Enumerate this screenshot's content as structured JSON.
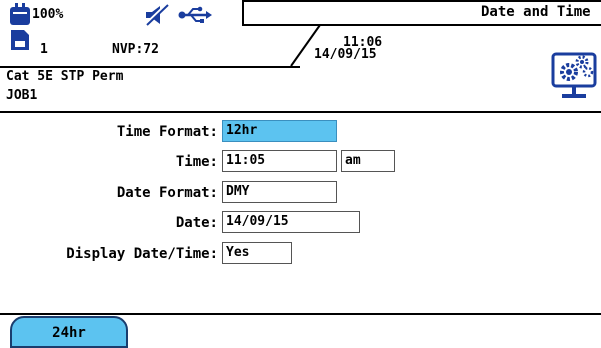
{
  "status": {
    "battery_text": "100%",
    "profile_number": "1",
    "nvp_label": "NVP:72",
    "time": "11:06",
    "date": "14/09/15"
  },
  "header": {
    "screen_title": "Date and Time",
    "cable_type": "Cat 5E STP Perm",
    "job_name": "JOB1"
  },
  "settings": {
    "time_format": {
      "label": "Time Format:",
      "value": "12hr"
    },
    "time": {
      "label": "Time:",
      "value": "11:05",
      "ampm": "am"
    },
    "date_format": {
      "label": "Date Format:",
      "value": "DMY"
    },
    "date": {
      "label": "Date:",
      "value": "14/09/15"
    },
    "display_date_time": {
      "label": "Display Date/Time:",
      "value": "Yes"
    }
  },
  "softkeys": [
    {
      "label": "24hr"
    }
  ],
  "colors": {
    "selected": "#5cc3f0",
    "icon_blue": "#1a3d9e"
  }
}
